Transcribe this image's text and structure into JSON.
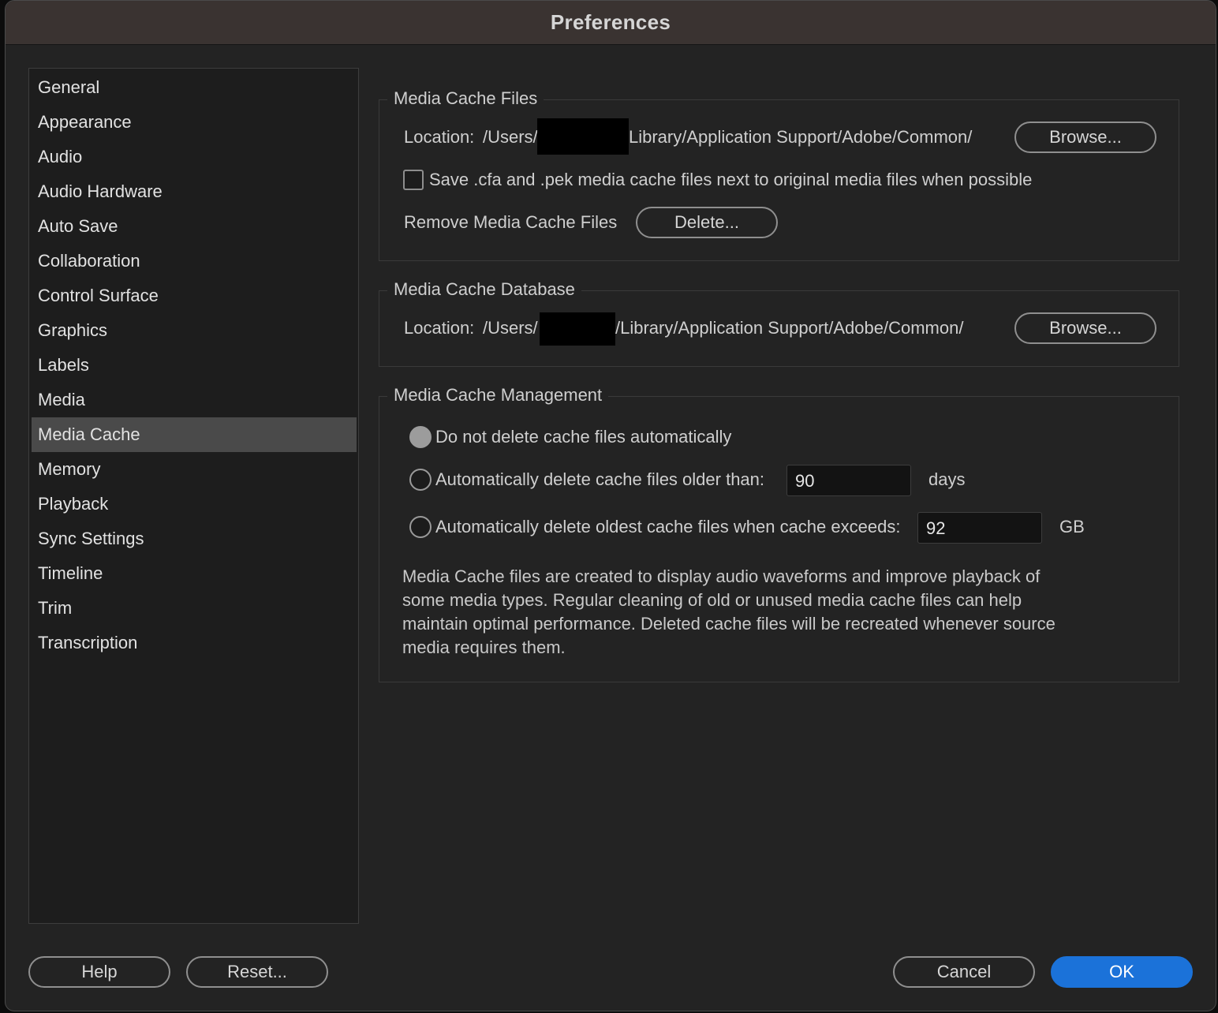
{
  "window": {
    "title": "Preferences"
  },
  "sidebar": {
    "items": [
      {
        "label": "General",
        "selected": false
      },
      {
        "label": "Appearance",
        "selected": false
      },
      {
        "label": "Audio",
        "selected": false
      },
      {
        "label": "Audio Hardware",
        "selected": false
      },
      {
        "label": "Auto Save",
        "selected": false
      },
      {
        "label": "Collaboration",
        "selected": false
      },
      {
        "label": "Control Surface",
        "selected": false
      },
      {
        "label": "Graphics",
        "selected": false
      },
      {
        "label": "Labels",
        "selected": false
      },
      {
        "label": "Media",
        "selected": false
      },
      {
        "label": "Media Cache",
        "selected": true
      },
      {
        "label": "Memory",
        "selected": false
      },
      {
        "label": "Playback",
        "selected": false
      },
      {
        "label": "Sync Settings",
        "selected": false
      },
      {
        "label": "Timeline",
        "selected": false
      },
      {
        "label": "Trim",
        "selected": false
      },
      {
        "label": "Transcription",
        "selected": false
      }
    ]
  },
  "media_cache_files": {
    "legend": "Media Cache Files",
    "location_label": "Location:",
    "location_prefix": "/Users/",
    "location_suffix": "Library/Application Support/Adobe/Common/",
    "browse_label": "Browse...",
    "save_next_to_media_label": "Save .cfa and .pek media cache files next to original media files when possible",
    "save_next_to_media_checked": false,
    "remove_label": "Remove Media Cache Files",
    "delete_label": "Delete..."
  },
  "media_cache_database": {
    "legend": "Media Cache Database",
    "location_label": "Location:",
    "location_prefix": "/Users/",
    "location_suffix": "/Library/Application Support/Adobe/Common/",
    "browse_label": "Browse..."
  },
  "media_cache_management": {
    "legend": "Media Cache Management",
    "options": [
      {
        "label": "Do not delete cache files automatically",
        "checked": true
      },
      {
        "label": "Automatically delete cache files older than:",
        "checked": false,
        "value": "90",
        "unit": "days"
      },
      {
        "label": "Automatically delete oldest cache files when cache exceeds:",
        "checked": false,
        "value": "92",
        "unit": "GB"
      }
    ],
    "description": "Media Cache files are created to display audio waveforms and improve playback of some media types.  Regular cleaning of old or unused media cache files can help maintain optimal performance. Deleted cache files will be recreated whenever source media requires them."
  },
  "footer": {
    "help_label": "Help",
    "reset_label": "Reset...",
    "cancel_label": "Cancel",
    "ok_label": "OK"
  },
  "colors": {
    "accent": "#1b72d9",
    "background": "#232323",
    "selected_item": "#4a4a4a"
  }
}
